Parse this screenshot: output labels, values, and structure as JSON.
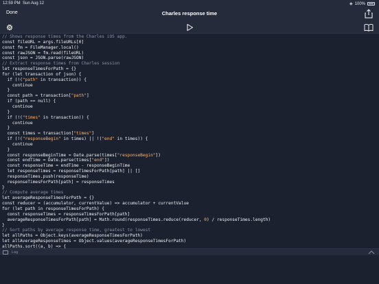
{
  "status": {
    "time": "12:59 PM",
    "date": "Sun Aug 12",
    "battery": "100%"
  },
  "nav": {
    "done_label": "Done",
    "title": "Charles response time"
  },
  "icons": {
    "settings": "gear-icon",
    "run": "play-icon",
    "share": "share-icon",
    "docs": "book-icon",
    "log": "log-icon",
    "expand": "chevron-up-icon"
  },
  "colors": {
    "background": "#1c2130",
    "bar": "#252b3b",
    "comment": "#8a93a6",
    "string": "#ffb46a",
    "text": "#f0f2f5"
  },
  "log": {
    "label": "Log"
  },
  "code": [
    [
      {
        "t": "// Shows response times from the Charles iOS app.",
        "k": "comment"
      }
    ],
    [
      {
        "t": "const fileURL = args.fileURLs[0]",
        "k": "plain"
      }
    ],
    [
      {
        "t": "const fm = FileManager.local()",
        "k": "plain"
      }
    ],
    [
      {
        "t": "const rawJSON = fm.read(fileURL)",
        "k": "plain"
      }
    ],
    [
      {
        "t": "const json = JSON.parse(rawJSON)",
        "k": "plain"
      }
    ],
    [
      {
        "t": "// Extract response times from Charles session",
        "k": "comment"
      }
    ],
    [
      {
        "t": "let responseTimesForPath = {}",
        "k": "plain"
      }
    ],
    [
      {
        "t": "for (let transaction of json) {",
        "k": "plain"
      }
    ],
    [
      {
        "t": "  if (!(",
        "k": "plain"
      },
      {
        "t": "\"path\"",
        "k": "string"
      },
      {
        "t": " in transaction)) {",
        "k": "plain"
      }
    ],
    [
      {
        "t": "    continue",
        "k": "plain"
      }
    ],
    [
      {
        "t": "  }",
        "k": "plain"
      }
    ],
    [
      {
        "t": "  const path = transaction[",
        "k": "plain"
      },
      {
        "t": "\"path\"",
        "k": "string"
      },
      {
        "t": "]",
        "k": "plain"
      }
    ],
    [
      {
        "t": "  if (path == null) {",
        "k": "plain"
      }
    ],
    [
      {
        "t": "    continue",
        "k": "plain"
      }
    ],
    [
      {
        "t": "  }",
        "k": "plain"
      }
    ],
    [
      {
        "t": "  if (!(",
        "k": "plain"
      },
      {
        "t": "\"times\"",
        "k": "string"
      },
      {
        "t": " in transaction)) {",
        "k": "plain"
      }
    ],
    [
      {
        "t": "    continue",
        "k": "plain"
      }
    ],
    [
      {
        "t": "  }",
        "k": "plain"
      }
    ],
    [
      {
        "t": "  const times = transaction[",
        "k": "plain"
      },
      {
        "t": "\"times\"",
        "k": "string"
      },
      {
        "t": "]",
        "k": "plain"
      }
    ],
    [
      {
        "t": "  if (!(",
        "k": "plain"
      },
      {
        "t": "\"responseBegin\"",
        "k": "string"
      },
      {
        "t": " in times) || !(",
        "k": "plain"
      },
      {
        "t": "\"end\"",
        "k": "string"
      },
      {
        "t": " in times)) {",
        "k": "plain"
      }
    ],
    [
      {
        "t": "    continue",
        "k": "plain"
      }
    ],
    [
      {
        "t": "  }",
        "k": "plain"
      }
    ],
    [
      {
        "t": "  const responseBeginTime = Date.parse(times[",
        "k": "plain"
      },
      {
        "t": "\"responseBegin\"",
        "k": "string"
      },
      {
        "t": "])",
        "k": "plain"
      }
    ],
    [
      {
        "t": "  const endTime = Date.parse(times[",
        "k": "plain"
      },
      {
        "t": "\"end\"",
        "k": "string"
      },
      {
        "t": "])",
        "k": "plain"
      }
    ],
    [
      {
        "t": "  const responseTime = endTime - responseBeginTime",
        "k": "plain"
      }
    ],
    [
      {
        "t": "  let responseTimes = responseTimesForPath[path] || []",
        "k": "plain"
      }
    ],
    [
      {
        "t": "  responseTimes.push(responseTime)",
        "k": "plain"
      }
    ],
    [
      {
        "t": "  responseTimesForPath[path] = responseTimes",
        "k": "plain"
      }
    ],
    [
      {
        "t": "}",
        "k": "plain"
      }
    ],
    [
      {
        "t": "// Compute average times",
        "k": "comment"
      }
    ],
    [
      {
        "t": "let averageResponseTimesForPath = {}",
        "k": "plain"
      }
    ],
    [
      {
        "t": "const reducer = (accumulator, currentValue) => accumulator + currentValue",
        "k": "plain"
      }
    ],
    [
      {
        "t": "for (let path in responseTimesForPath) {",
        "k": "plain"
      }
    ],
    [
      {
        "t": "  const responseTimes = responseTimesForPath[path]",
        "k": "plain"
      }
    ],
    [
      {
        "t": "  averageResponseTimesForPath[path] = Math.round(responseTimes.reduce(reducer, ",
        "k": "plain"
      },
      {
        "t": "0",
        "k": "number"
      },
      {
        "t": ") / responseTimes.length)",
        "k": "plain"
      }
    ],
    [
      {
        "t": "}",
        "k": "plain"
      }
    ],
    [
      {
        "t": "// Sort paths by average response time, greatest to lowest",
        "k": "comment"
      }
    ],
    [
      {
        "t": "let allPaths = Object.keys(averageResponseTimesForPath)",
        "k": "plain"
      }
    ],
    [
      {
        "t": "let allAverageResponseTimes = Object.values(averageResponseTimesForPath)",
        "k": "plain"
      }
    ],
    [
      {
        "t": "allPaths.sort((a, b) => {",
        "k": "plain"
      }
    ]
  ]
}
